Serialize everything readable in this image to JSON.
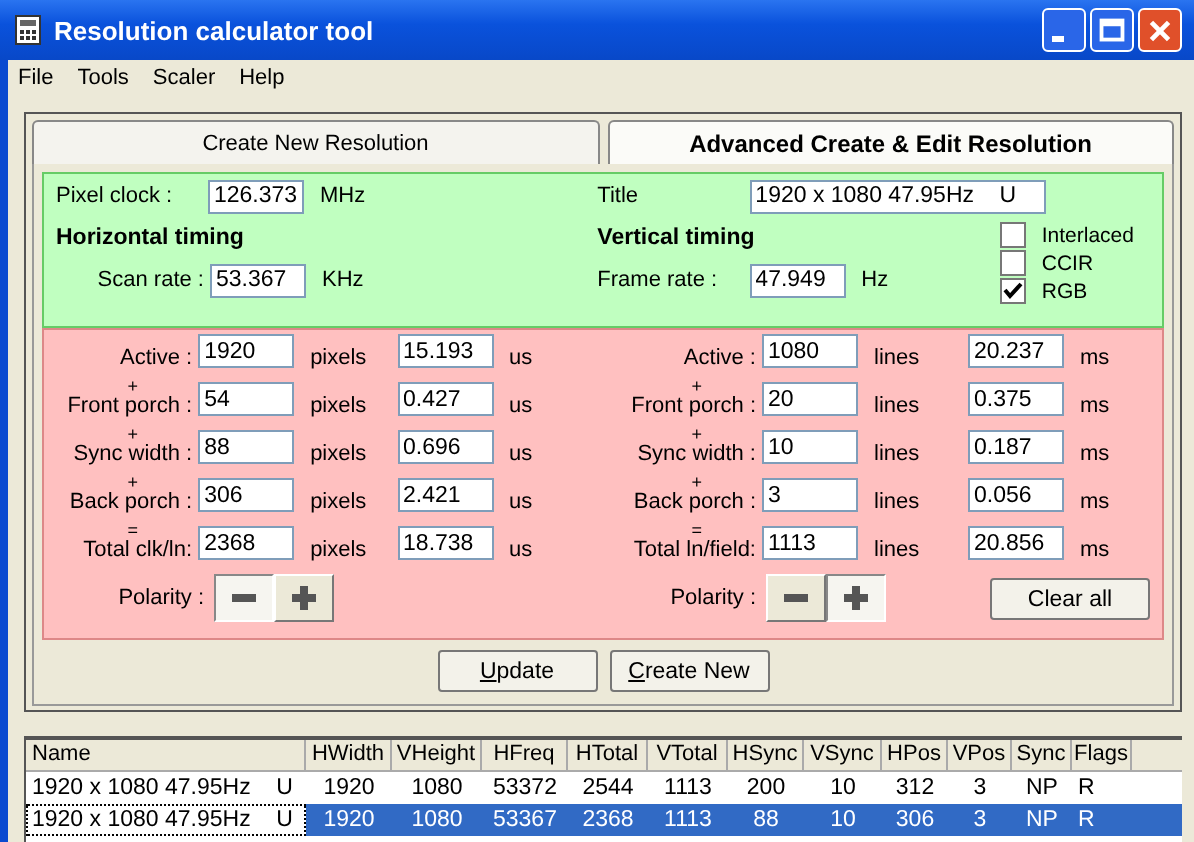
{
  "window": {
    "title": "Resolution calculator tool"
  },
  "menu": [
    "File",
    "Tools",
    "Scaler",
    "Help"
  ],
  "tabs": [
    {
      "label": "Create New Resolution",
      "selected": false
    },
    {
      "label": "Advanced Create & Edit Resolution",
      "selected": true
    }
  ],
  "general": {
    "pixel_clock": {
      "label": "Pixel clock :",
      "value": "126.373",
      "unit": "MHz"
    },
    "title": {
      "label": "Title",
      "value": "1920 x 1080 47.95Hz    U"
    }
  },
  "horizontal": {
    "heading": "Horizontal timing",
    "rate": {
      "label": "Scan rate :",
      "value": "53.367",
      "unit": "KHz"
    },
    "rows": [
      {
        "op": "",
        "label": "Active :",
        "value": "1920",
        "unit": "pixels",
        "time": "15.193",
        "time_unit": "us"
      },
      {
        "op": "+",
        "label": "Front porch :",
        "value": "54",
        "unit": "pixels",
        "time": "0.427",
        "time_unit": "us"
      },
      {
        "op": "+",
        "label": "Sync width :",
        "value": "88",
        "unit": "pixels",
        "time": "0.696",
        "time_unit": "us"
      },
      {
        "op": "+",
        "label": "Back porch :",
        "value": "306",
        "unit": "pixels",
        "time": "2.421",
        "time_unit": "us"
      },
      {
        "op": "=",
        "label": "Total clk/ln:",
        "value": "2368",
        "unit": "pixels",
        "time": "18.738",
        "time_unit": "us"
      }
    ],
    "polarity": {
      "label": "Polarity :",
      "buttons": [
        {
          "kind": "minus",
          "selected": true
        },
        {
          "kind": "plus",
          "selected": false
        }
      ]
    }
  },
  "vertical": {
    "heading": "Vertical timing",
    "rate": {
      "label": "Frame rate :",
      "value": "47.949",
      "unit": "Hz"
    },
    "rows": [
      {
        "op": "",
        "label": "Active :",
        "value": "1080",
        "unit": "lines",
        "time": "20.237",
        "time_unit": "ms"
      },
      {
        "op": "+",
        "label": "Front porch :",
        "value": "20",
        "unit": "lines",
        "time": "0.375",
        "time_unit": "ms"
      },
      {
        "op": "+",
        "label": "Sync width :",
        "value": "10",
        "unit": "lines",
        "time": "0.187",
        "time_unit": "ms"
      },
      {
        "op": "+",
        "label": "Back porch :",
        "value": "3",
        "unit": "lines",
        "time": "0.056",
        "time_unit": "ms"
      },
      {
        "op": "=",
        "label": "Total ln/field:",
        "value": "1113",
        "unit": "lines",
        "time": "20.856",
        "time_unit": "ms"
      }
    ],
    "polarity": {
      "label": "Polarity :",
      "buttons": [
        {
          "kind": "minus",
          "selected": false
        },
        {
          "kind": "plus",
          "selected": true
        }
      ]
    }
  },
  "checkboxes": [
    {
      "label": "Interlaced",
      "checked": false
    },
    {
      "label": "CCIR",
      "checked": false
    },
    {
      "label": "RGB",
      "checked": true
    }
  ],
  "clear_button": "Clear all",
  "buttons": [
    "Update",
    "Create New"
  ],
  "table": {
    "columns": [
      "Name",
      "HWidth",
      "VHeight",
      "HFreq",
      "HTotal",
      "VTotal",
      "HSync",
      "VSync",
      "HPos",
      "VPos",
      "Sync",
      "Flags"
    ],
    "rows": [
      {
        "selected": false,
        "cells": [
          "1920 x 1080 47.95Hz    U",
          "1920",
          "1080",
          "53372",
          "2544",
          "1113",
          "200",
          "10",
          "312",
          "3",
          "NP",
          "R"
        ]
      },
      {
        "selected": true,
        "cells": [
          "1920 x 1080 47.95Hz    U",
          "1920",
          "1080",
          "53367",
          "2368",
          "1113",
          "88",
          "10",
          "306",
          "3",
          "NP",
          "R"
        ]
      }
    ]
  }
}
